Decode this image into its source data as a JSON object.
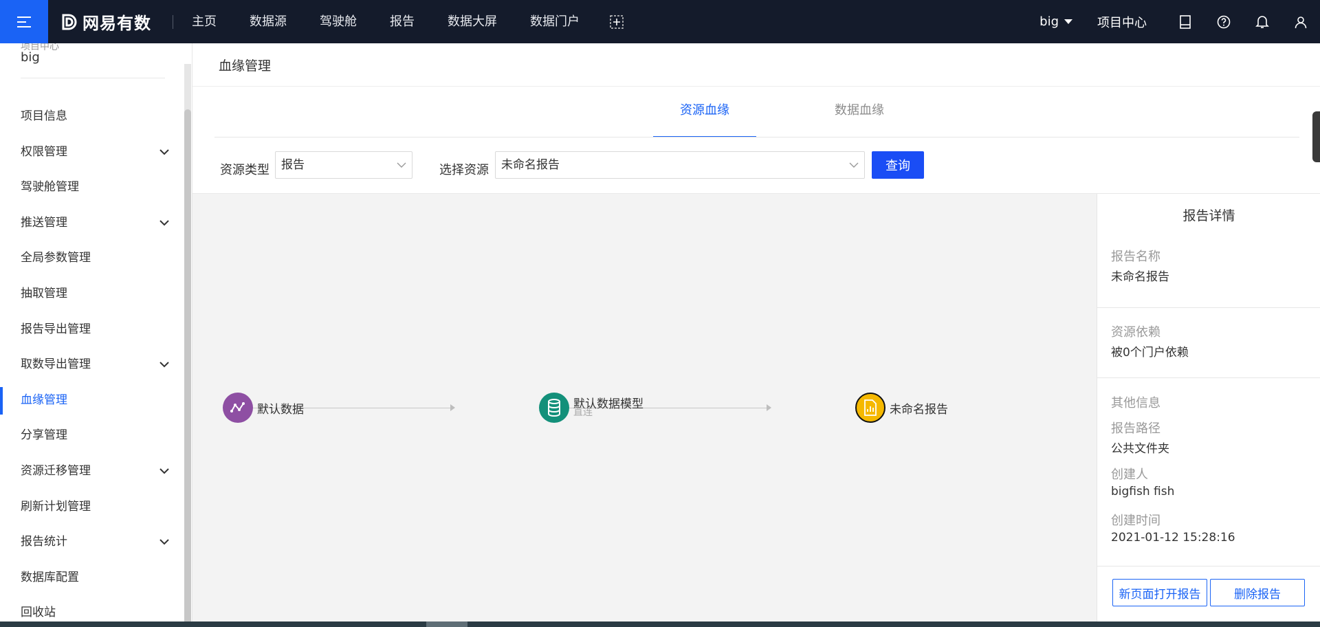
{
  "header": {
    "logo_text": "网易有数",
    "nav": [
      "主页",
      "数据源",
      "驾驶舱",
      "报告",
      "数据大屏",
      "数据门户"
    ],
    "user": "big",
    "project_center": "项目中心"
  },
  "sidebar": {
    "project_label": "项目中心",
    "project_name": "big",
    "items": [
      {
        "label": "项目信息"
      },
      {
        "label": "权限管理"
      },
      {
        "label": "驾驶舱管理"
      },
      {
        "label": "推送管理"
      },
      {
        "label": "全局参数管理"
      },
      {
        "label": "抽取管理"
      },
      {
        "label": "报告导出管理"
      },
      {
        "label": "取数导出管理"
      },
      {
        "label": "血缘管理"
      },
      {
        "label": "分享管理"
      },
      {
        "label": "资源迁移管理"
      },
      {
        "label": "刷新计划管理"
      },
      {
        "label": "报告统计"
      },
      {
        "label": "数据库配置"
      },
      {
        "label": "回收站"
      }
    ]
  },
  "main": {
    "title": "血缘管理",
    "tabs": [
      "资源血缘",
      "数据血缘"
    ],
    "filter": {
      "resource_type_label": "资源类型",
      "resource_type_value": "报告",
      "select_resource_label": "选择资源",
      "select_resource_value": "未命名报告",
      "query_button": "查询"
    },
    "lineage": {
      "nodes": [
        {
          "label": "默认数据",
          "sub": "",
          "color": "#8e4fa3"
        },
        {
          "label": "默认数据模型",
          "sub": "直连",
          "color": "#13907a"
        },
        {
          "label": "未命名报告",
          "sub": "",
          "color": "#f5b800"
        }
      ]
    },
    "details": {
      "title": "报告详情",
      "name_label": "报告名称",
      "name_value": "未命名报告",
      "dependency_label": "资源依赖",
      "dependency_value": "被0个门户依赖",
      "other_label": "其他信息",
      "path_label": "报告路径",
      "path_value": "公共文件夹",
      "creator_label": "创建人",
      "creator_value": "bigfish fish",
      "created_time_label": "创建时间",
      "created_time_value": "2021-01-12 15:28:16",
      "open_button": "新页面打开报告",
      "delete_button": "删除报告"
    }
  },
  "colors": {
    "accent": "#1a63f5",
    "topbar": "#141b2b"
  }
}
